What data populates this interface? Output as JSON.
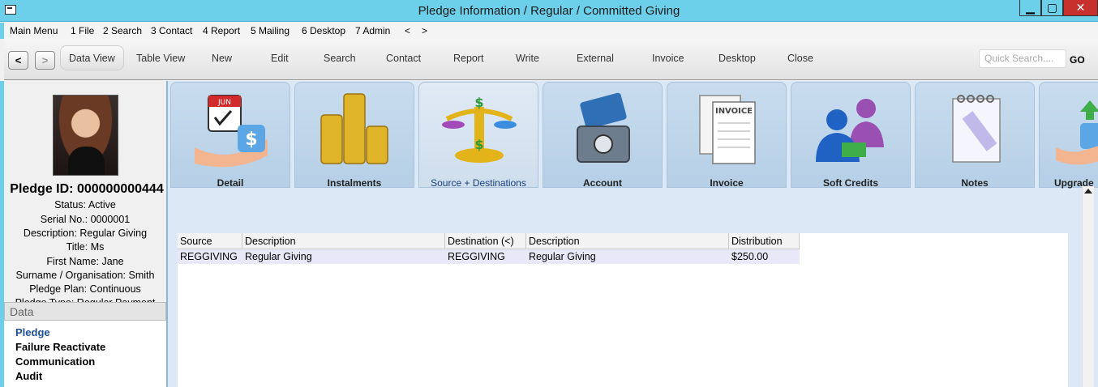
{
  "window": {
    "title": "Pledge Information / Regular / Committed Giving"
  },
  "menu": [
    "Main Menu",
    "1 File",
    "2 Search",
    "3 Contact",
    "4 Report",
    "5 Mailing",
    "6 Desktop",
    "7 Admin",
    "<",
    ">"
  ],
  "toolbar": {
    "back": "<",
    "forward": ">",
    "items": [
      "Data View",
      "Table View",
      "New",
      "Edit",
      "Search",
      "Contact",
      "Report",
      "Write",
      "External",
      "Invoice",
      "Desktop",
      "Close"
    ],
    "quick_search_placeholder": "Quick Search....",
    "go_label": "GO"
  },
  "pledge": {
    "id_line": "Pledge ID: 000000000444",
    "status": "Status: Active",
    "serial": "Serial No.: 0000001",
    "description": "Description: Regular Giving",
    "title": "Title: Ms",
    "first_name": "First Name: Jane",
    "surname": "Surname / Organisation: Smith",
    "plan": "Pledge Plan: Continuous",
    "type": "Pledge Type: Regular Payment"
  },
  "data_panel": {
    "header": "Data",
    "links": [
      "Pledge",
      "Failure Reactivate",
      "Communication",
      "Audit"
    ]
  },
  "tabs": [
    {
      "label": "Detail",
      "icon": "calendar-hand-icon"
    },
    {
      "label": "Instalments",
      "icon": "coins-icon"
    },
    {
      "label": "Source + Destinations",
      "icon": "scales-icon",
      "active": true
    },
    {
      "label": "Account",
      "icon": "credit-card-safe-icon"
    },
    {
      "label": "Invoice",
      "icon": "invoice-icon"
    },
    {
      "label": "Soft Credits",
      "icon": "people-icon"
    },
    {
      "label": "Notes",
      "icon": "notepad-icon"
    },
    {
      "label": "Upgrade",
      "icon": "upgrade-icon"
    }
  ],
  "grid": {
    "columns": [
      "Source",
      "Description",
      "Destination (<)",
      "Description",
      "Distribution"
    ],
    "rows": [
      [
        "REGGIVING",
        "Regular Giving",
        "REGGIVING",
        "Regular Giving",
        "$250.00"
      ]
    ]
  },
  "colors": {
    "titlebar": "#6dd0eb",
    "active_tab_text": "#16407a",
    "link_blue": "#1c4f93"
  }
}
